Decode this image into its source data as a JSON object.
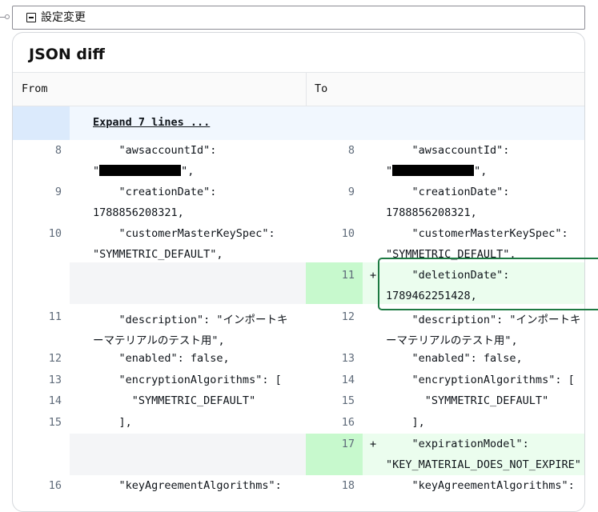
{
  "section": {
    "title": "設定変更"
  },
  "panel": {
    "title": "JSON diff"
  },
  "columns": {
    "from": "From",
    "to": "To"
  },
  "expand": {
    "label": "Expand 7 lines ..."
  },
  "diff": {
    "l8_a": "    \"awsaccountId\":",
    "l8_b_pre": "\"",
    "l8_b_post": "\",",
    "l9_a": "    \"creationDate\":",
    "l9_b": "1788856208321,",
    "l10_a": "    \"customerMasterKeySpec\":",
    "l10_b": "\"SYMMETRIC_DEFAULT\",",
    "add1_a": "    \"deletionDate\":",
    "add1_b": "1789462251428,",
    "desc_a": "    \"description\": \"インポートキ",
    "desc_b": "ーマテリアルのテスト用\",",
    "enabled": "    \"enabled\": false,",
    "enc": "    \"encryptionAlgorithms\": [",
    "sym": "      \"SYMMETRIC_DEFAULT\"",
    "close": "    ],",
    "add2_a": "    \"expirationModel\":",
    "add2_b": "\"KEY_MATERIAL_DOES_NOT_EXPIRE\"",
    "keyagree": "    \"keyAgreementAlgorithms\":",
    "plus": "+"
  },
  "numbers": {
    "left": [
      "8",
      "9",
      "10",
      "11",
      "12",
      "13",
      "14",
      "15",
      "16"
    ],
    "right": [
      "8",
      "9",
      "10",
      "11",
      "12",
      "13",
      "14",
      "15",
      "16",
      "17",
      "18"
    ]
  },
  "colors": {
    "added_gutter": "#c7f9cd",
    "added_body": "#ebfdee",
    "highlight": "#1e7a43"
  }
}
